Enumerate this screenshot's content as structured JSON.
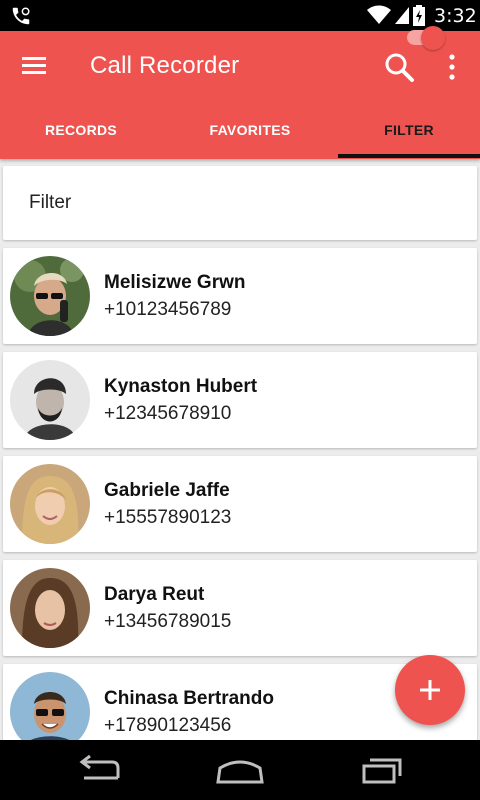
{
  "status_bar": {
    "time": "3:32",
    "icons": [
      "call-icon",
      "wifi-icon",
      "signal-icon",
      "battery-icon"
    ]
  },
  "app_bar": {
    "title": "Call Recorder",
    "icons": [
      "menu-icon",
      "search-icon",
      "more-vert-icon"
    ]
  },
  "tabs": [
    {
      "label": "RECORDS",
      "active": false
    },
    {
      "label": "FAVORITES",
      "active": false
    },
    {
      "label": "FILTER",
      "active": true
    }
  ],
  "filter": {
    "label": "Filter",
    "enabled": true
  },
  "contacts": [
    {
      "name": "Melisizwe Grwn",
      "number": "+10123456789"
    },
    {
      "name": "Kynaston Hubert",
      "number": "+12345678910"
    },
    {
      "name": "Gabriele Jaffe",
      "number": "+15557890123"
    },
    {
      "name": "Darya Reut",
      "number": "+13456789015"
    },
    {
      "name": "Chinasa Bertrando",
      "number": "+17890123456"
    }
  ],
  "fab": {
    "icon": "plus-icon"
  },
  "nav_bar": {
    "icons": [
      "back-icon",
      "home-icon",
      "recents-icon"
    ]
  },
  "colors": {
    "accent": "#ef5350",
    "accent_light": "#f6a3a1",
    "background": "#ececec"
  }
}
